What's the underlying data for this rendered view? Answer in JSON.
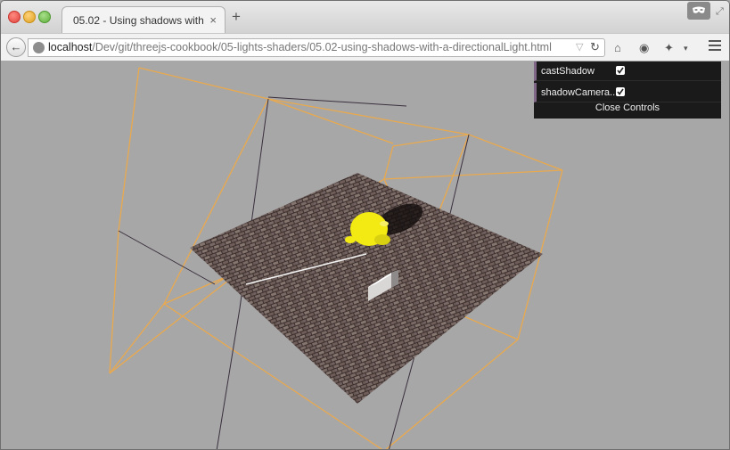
{
  "browser": {
    "tab_title": "05.02 - Using shadows with a...",
    "tab_close": "×",
    "new_tab": "+",
    "url_host": "localhost",
    "url_path": "/Dev/git/threejs-cookbook/05-lights-shaders/05.02-using-shadows-with-a-directionalLight.html",
    "icons": [
      "back-arrow-icon",
      "globe-icon",
      "bookmark-star-icon",
      "reload-icon",
      "home-icon",
      "pocket-icon",
      "tools-icon",
      "menu-icon",
      "private-mask-icon",
      "fullscreen-icon"
    ]
  },
  "controls": {
    "cast_shadow_label": "castShadow",
    "cast_shadow_checked": true,
    "shadow_camera_label": "shadowCamera...",
    "shadow_camera_checked": true,
    "close_label": "Close Controls",
    "accent_color": "#806787"
  },
  "scene": {
    "background_color": "#a7a7a7",
    "frustum_color": "#e9a94e",
    "floor_texture": "brick",
    "model_color": "#f2ea12",
    "cube_color": "#f7f7f7"
  }
}
